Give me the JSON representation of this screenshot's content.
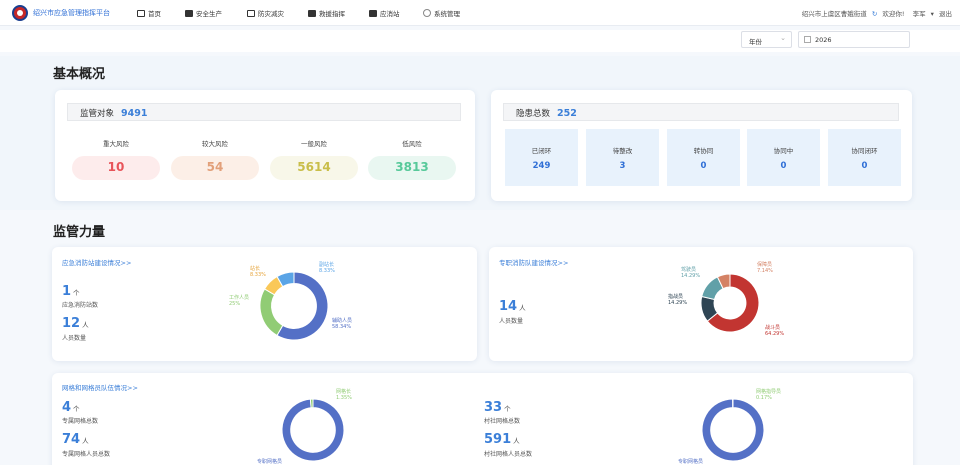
{
  "header": {
    "app_title": "绍兴市应急管理指挥平台",
    "nav": [
      "首页",
      "安全生产",
      "防灾减灾",
      "救援指挥",
      "应消站",
      "系统管理"
    ],
    "location": "绍兴市上虞区曹娥街道",
    "welcome": "欢迎你!",
    "user": "李军",
    "logout": "退出"
  },
  "filters": {
    "period": "年份",
    "year": "2026"
  },
  "overview": {
    "title": "基本概况",
    "supervision_label": "监管对象",
    "supervision_total": "9491",
    "risks": [
      {
        "label": "重大风险",
        "value": "10",
        "color": "#e8545a",
        "bg": "#fdecec"
      },
      {
        "label": "较大风险",
        "value": "54",
        "color": "#e2a07a",
        "bg": "#fcefe7"
      },
      {
        "label": "一般风险",
        "value": "5614",
        "color": "#c9be4a",
        "bg": "#f8f7e9"
      },
      {
        "label": "低风险",
        "value": "3813",
        "color": "#57c99a",
        "bg": "#e9f7f1"
      }
    ],
    "hazard_label": "隐患总数",
    "hazard_total": "252",
    "hazards": [
      {
        "label": "已闭环",
        "value": "249"
      },
      {
        "label": "待整改",
        "value": "3"
      },
      {
        "label": "转协同",
        "value": "0"
      },
      {
        "label": "协同中",
        "value": "0"
      },
      {
        "label": "协同闭环",
        "value": "0"
      }
    ]
  },
  "force": {
    "title": "监管力量",
    "station": {
      "link": "应急消防站建设情况>>",
      "count": "1",
      "count_unit": "个",
      "count_label": "应急消防站数",
      "people": "12",
      "people_unit": "人",
      "people_label": "人员数量",
      "pie": [
        {
          "name": "辅助人员",
          "pct": "58.34%",
          "value": 58.34,
          "color": "#5470c6"
        },
        {
          "name": "工作人员",
          "pct": "25%",
          "value": 25,
          "color": "#91cc75"
        },
        {
          "name": "站长",
          "pct": "8.33%",
          "value": 8.33,
          "color": "#fac858"
        },
        {
          "name": "副站长",
          "pct": "8.33%",
          "value": 8.33,
          "color": "#5aa4e6"
        }
      ]
    },
    "team": {
      "link": "专职消防队建设情况>>",
      "people": "14",
      "people_unit": "人",
      "people_label": "人员数量",
      "pie": [
        {
          "name": "战斗员",
          "pct": "64.29%",
          "value": 64.29,
          "color": "#c23531"
        },
        {
          "name": "指战员",
          "pct": "14.29%",
          "value": 14.29,
          "color": "#2f4554"
        },
        {
          "name": "驾驶员",
          "pct": "14.29%",
          "value": 14.29,
          "color": "#61a0a8"
        },
        {
          "name": "保障员",
          "pct": "7.14%",
          "value": 7.14,
          "color": "#d48265"
        }
      ]
    },
    "grid": {
      "link": "网格和网格员队伍情况>>",
      "left": {
        "count": "4",
        "count_unit": "个",
        "count_label": "专属网格总数",
        "people": "74",
        "people_unit": "人",
        "people_label": "专属网格人员总数",
        "pie": [
          {
            "name": "专职网格员",
            "pct": "",
            "value": 98.65,
            "color": "#5470c6"
          },
          {
            "name": "网格长",
            "pct": "1.35%",
            "value": 1.35,
            "color": "#91cc75"
          }
        ]
      },
      "right": {
        "count": "33",
        "count_unit": "个",
        "count_label": "村社网格总数",
        "people": "591",
        "people_unit": "人",
        "people_label": "村社网格人员总数",
        "pie": [
          {
            "name": "专职网格员",
            "pct": "",
            "value": 99.83,
            "color": "#5470c6"
          },
          {
            "name": "网格指导员",
            "pct": "0.17%",
            "value": 0.17,
            "color": "#91cc75"
          }
        ]
      }
    }
  }
}
